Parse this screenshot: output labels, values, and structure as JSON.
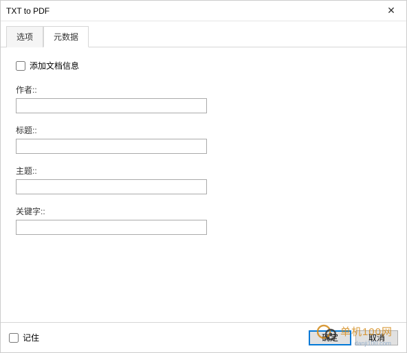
{
  "window": {
    "title": "TXT to PDF"
  },
  "tabs": {
    "options": "选项",
    "metadata": "元数据"
  },
  "form": {
    "add_doc_info_label": "添加文档信息",
    "author_label": "作者::",
    "author_value": "",
    "title_label": "标题::",
    "title_value": "",
    "subject_label": "主题::",
    "subject_value": "",
    "keywords_label": "关键字::",
    "keywords_value": ""
  },
  "footer": {
    "remember_label": "记住",
    "ok_label": "确定",
    "cancel_label": "取消"
  },
  "watermark": {
    "text": "单机100网",
    "sub": "danji100.com"
  }
}
